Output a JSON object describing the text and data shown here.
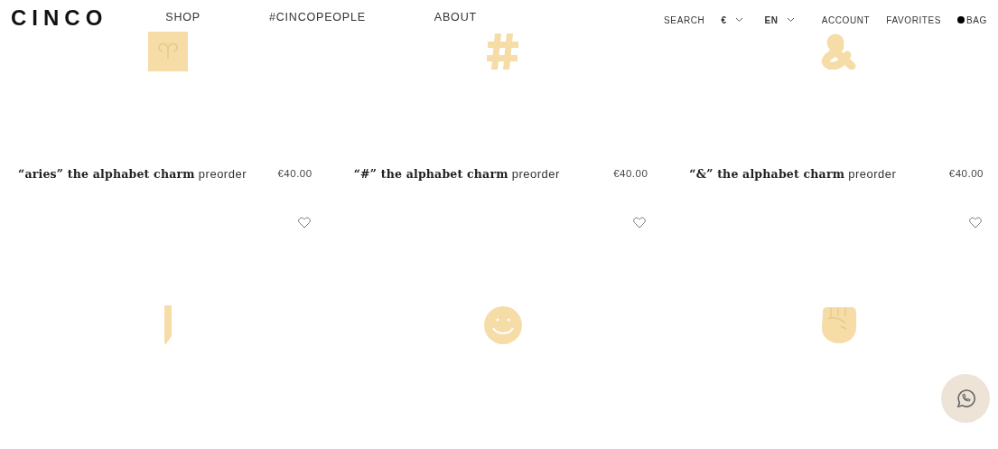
{
  "header": {
    "logo": "CINCO",
    "nav": [
      {
        "label": "SHOP"
      },
      {
        "label": "#CINCOPEOPLE"
      },
      {
        "label": "ABOUT"
      }
    ],
    "search": "SEARCH",
    "currency": "€",
    "language": "EN",
    "account": "ACCOUNT",
    "favorites": "FAVORITES",
    "bag": "BAG"
  },
  "products": [
    {
      "kind": "aries",
      "title": "**“aries” the alphabet charm** preorder",
      "price": "€40.00",
      "favorited": false
    },
    {
      "kind": "hash",
      "title": "**“#” the alphabet charm** preorder",
      "price": "€40.00",
      "favorited": false
    },
    {
      "kind": "ampersand",
      "title": "**“&” the alphabet charm** preorder",
      "price": "€40.00",
      "favorited": false
    },
    {
      "kind": "bar"
    },
    {
      "kind": "smile"
    },
    {
      "kind": "fist"
    }
  ]
}
